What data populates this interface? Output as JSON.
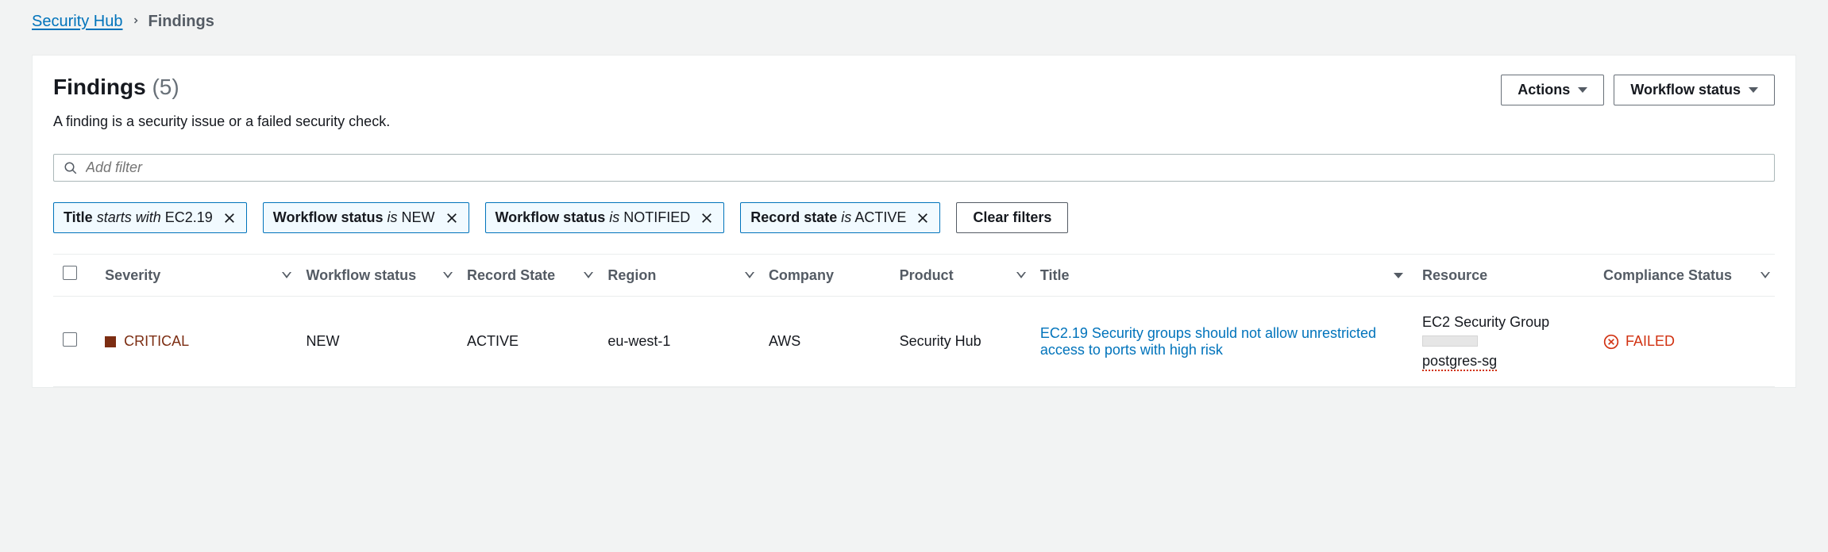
{
  "breadcrumb": {
    "root": "Security Hub",
    "current": "Findings"
  },
  "header": {
    "title": "Findings",
    "count": "(5)",
    "description": "A finding is a security issue or a failed security check.",
    "actions_label": "Actions",
    "workflow_status_label": "Workflow status"
  },
  "filter": {
    "placeholder": "Add filter",
    "clear_label": "Clear filters",
    "chips": [
      {
        "field": "Title",
        "op": "starts with",
        "value": "EC2.19"
      },
      {
        "field": "Workflow status",
        "op": "is",
        "value": "NEW"
      },
      {
        "field": "Workflow status",
        "op": "is",
        "value": "NOTIFIED"
      },
      {
        "field": "Record state",
        "op": "is",
        "value": "ACTIVE"
      }
    ]
  },
  "table": {
    "columns": {
      "severity": "Severity",
      "workflow_status": "Workflow status",
      "record_state": "Record State",
      "region": "Region",
      "company": "Company",
      "product": "Product",
      "title": "Title",
      "resource": "Resource",
      "compliance_status": "Compliance Status"
    },
    "rows": [
      {
        "severity": "CRITICAL",
        "workflow_status": "NEW",
        "record_state": "ACTIVE",
        "region": "eu-west-1",
        "company": "AWS",
        "product": "Security Hub",
        "title": "EC2.19 Security groups should not allow unrestricted access to ports with high risk",
        "resource_type": "EC2 Security Group",
        "resource_name": "postgres-sg",
        "compliance_status": "FAILED"
      }
    ]
  }
}
